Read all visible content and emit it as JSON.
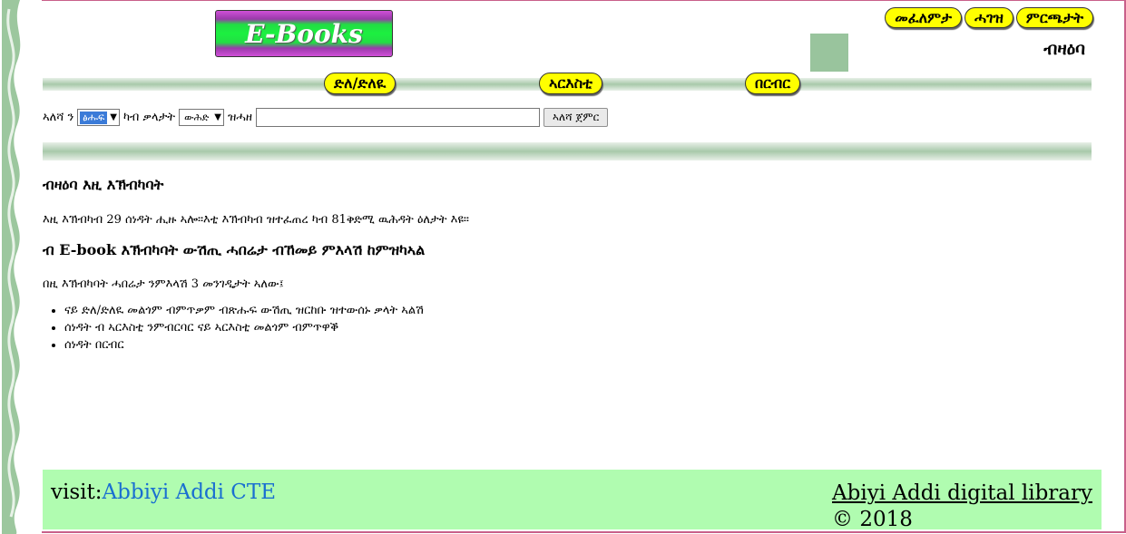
{
  "logo": {
    "text": "E-Books"
  },
  "topnav": [
    "መፈለምታ",
    "ሓገዝ",
    "ምርጫታት"
  ],
  "header": {
    "title": "ብዛዕባ"
  },
  "midnav": [
    "ድለ/ድለዪ",
    "ኣርእስቲ",
    "በርብር"
  ],
  "search": {
    "label_search": "ኣለሻ ን",
    "select1_value": "ፅሑፍ",
    "label_with_words": "ካብ ቃላታት",
    "select2_value": "ውሕድ",
    "label_input": "ዝሓዘ",
    "input_value": "",
    "button_label": "ኣለሻ ጀምር"
  },
  "content": {
    "heading1": "ብዛዕባ እዚ እኽብካባት",
    "para1": "እዚ እኽብካብ 29 ሰነዳት ሒዙ ኣሎ።እቲ እኽብካብ ዝተፈጠረ ካብ 81ቅድሚ ዉሕዳት ዕለታት እዩ።",
    "heading2": "ብ E-book እኽብካባት ውሽጢ ሓበሬታ ብኸመይ ምእላሽ ከምዝካኣል",
    "para2": "በዚ እኽብካባት ሓበሬታ ንምእላሽ 3 መንገዲታት ኣለው፤",
    "bullets": [
      "ናይ ድለ/ድለዪ መልጎም ብምጥቃም ብጽሑፍ ውሽጢ ዝርከቡ ዝተውሰኑ ቃላት ኣልሽ",
      "ሰነዳት ብ ኣርእስቲ ንምብርባር ናይ ኣርእስቲ መልጎም ብምጥዋቕ",
      "ሰነዳት በርብር"
    ]
  },
  "footer": {
    "visit_label": "visit:",
    "visit_link": "Abbiyi Addi CTE",
    "library_name": "Abiyi Addi digital library",
    "copyright": "© 2018"
  },
  "colors": {
    "pill": "#ffff00",
    "bar": "#a8c9aa",
    "footer_bg": "#b0fcb0",
    "link": "#1a6fd1",
    "frame": "#c9608a",
    "accent_square": "#99c49d"
  }
}
